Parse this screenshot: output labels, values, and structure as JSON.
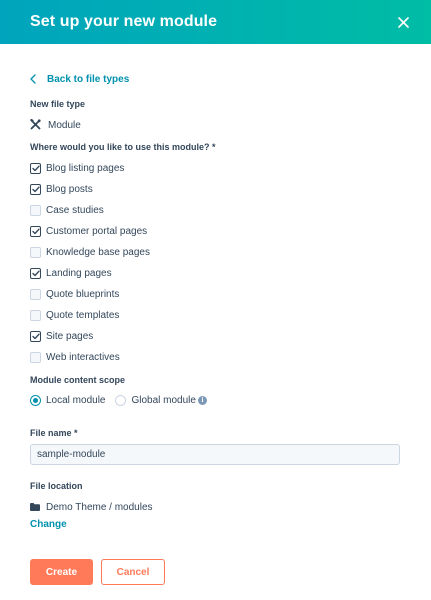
{
  "dialog": {
    "title": "Set up your new module",
    "back_link": "Back to file types",
    "file_type_label": "New file type",
    "file_type_value": "Module",
    "usage_label": "Where would you like to use this module? *",
    "usage_options": [
      {
        "label": "Blog listing pages",
        "checked": true
      },
      {
        "label": "Blog posts",
        "checked": true
      },
      {
        "label": "Case studies",
        "checked": false
      },
      {
        "label": "Customer portal pages",
        "checked": true
      },
      {
        "label": "Knowledge base pages",
        "checked": false
      },
      {
        "label": "Landing pages",
        "checked": true
      },
      {
        "label": "Quote blueprints",
        "checked": false
      },
      {
        "label": "Quote templates",
        "checked": false
      },
      {
        "label": "Site pages",
        "checked": true
      },
      {
        "label": "Web interactives",
        "checked": false
      }
    ],
    "scope_label": "Module content scope",
    "scope_options": [
      {
        "label": "Local module",
        "selected": true
      },
      {
        "label": "Global module",
        "selected": false
      }
    ],
    "file_name_label": "File name *",
    "file_name_value": "sample-module",
    "file_location_label": "File location",
    "file_location_value": "Demo Theme / modules",
    "change_link": "Change",
    "create_button": "Create",
    "cancel_button": "Cancel"
  },
  "icons": {
    "close": "close-icon",
    "back": "chevron-left-icon",
    "module": "module-tools-icon",
    "info": "info-icon",
    "folder": "folder-icon"
  },
  "colors": {
    "header_gradient_start": "#00a4bd",
    "header_gradient_end": "#00bda5",
    "link": "#0091ae",
    "primary_button": "#ff7a59",
    "text": "#33475b"
  }
}
